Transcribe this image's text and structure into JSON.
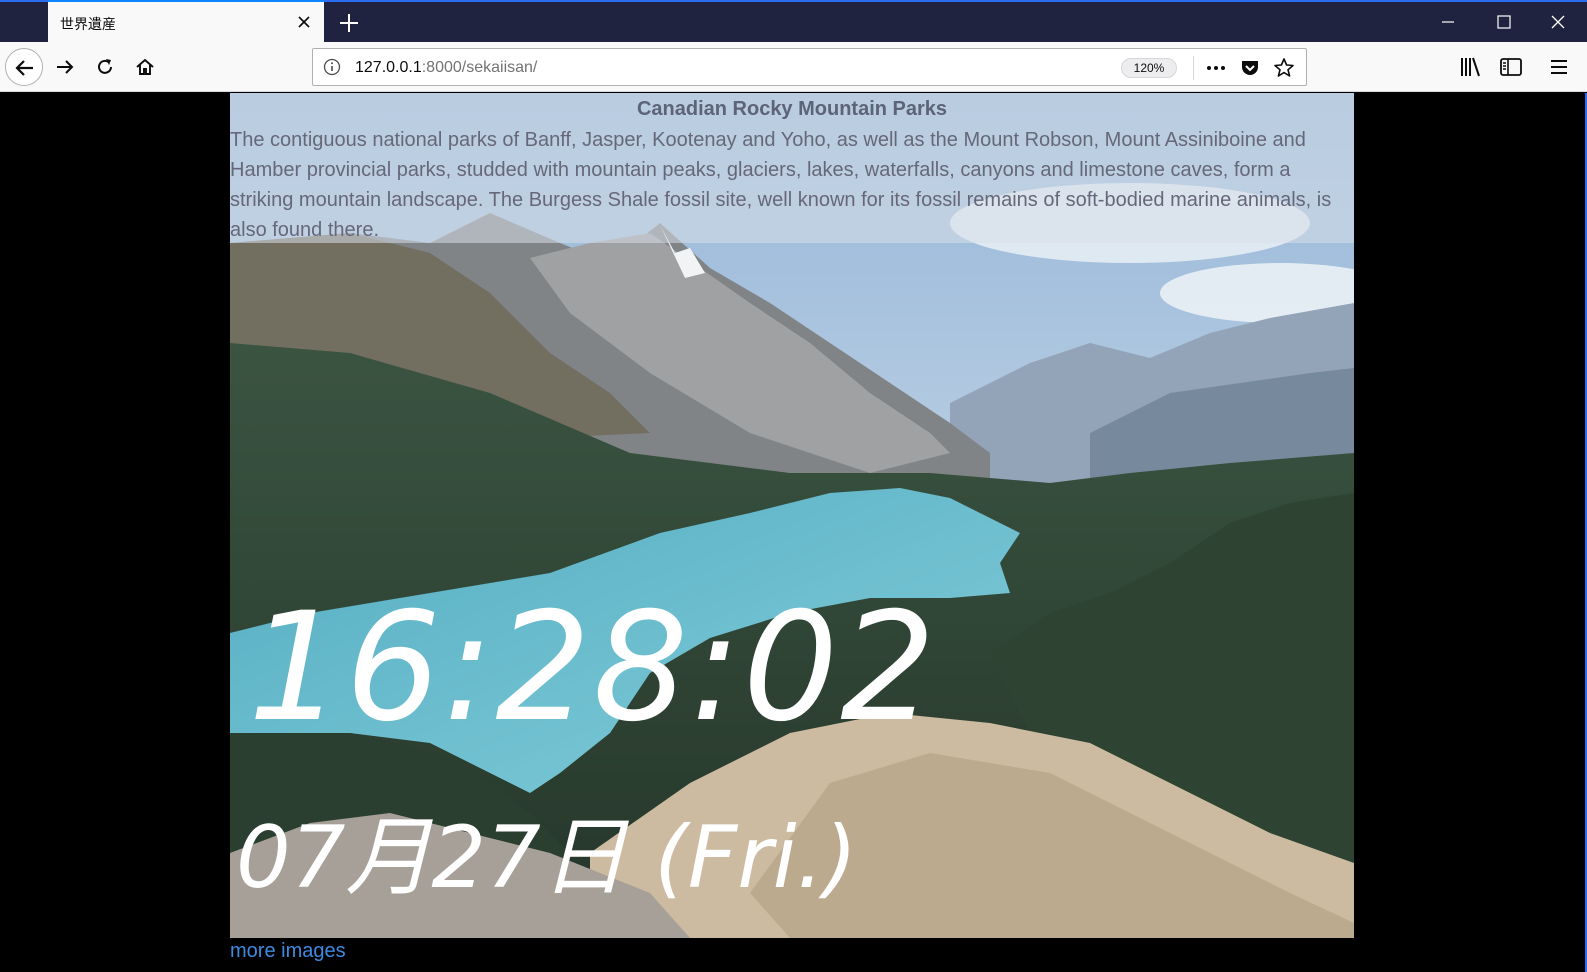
{
  "browser": {
    "tab_title": "世界遺産",
    "url_host": "127.0.0.1",
    "url_path": ":8000/sekaiisan/",
    "zoom": "120%"
  },
  "icons": {
    "tab_close": "close-icon",
    "new_tab": "plus-icon",
    "minimize": "minimize-icon",
    "maximize": "maximize-icon",
    "close_window": "close-icon",
    "back": "back-arrow-icon",
    "forward": "forward-arrow-icon",
    "reload": "reload-icon",
    "home": "home-icon",
    "info": "info-icon",
    "page_actions": "ellipsis-icon",
    "pocket": "pocket-icon",
    "bookmark": "star-icon",
    "library": "library-icon",
    "sidebar": "sidebar-icon",
    "menu": "hamburger-menu-icon"
  },
  "page": {
    "title": "Canadian Rocky Mountain Parks",
    "description": "The contiguous national parks of Banff, Jasper, Kootenay and Yoho, as well as the Mount Robson, Mount Assiniboine and Hamber provincial parks, studded with mountain peaks, glaciers, lakes, waterfalls, canyons and limestone caves, form a striking mountain landscape. The Burgess Shale fossil site, well known for its fossil remains of soft-bodied marine animals, is also found there.",
    "time": "16:28:02",
    "date": "07月27日 (Fri.)",
    "more_link": "more images"
  },
  "colors": {
    "titlebar": "#202340",
    "link": "#3f8ae0",
    "lake": "#5ab8cc"
  }
}
